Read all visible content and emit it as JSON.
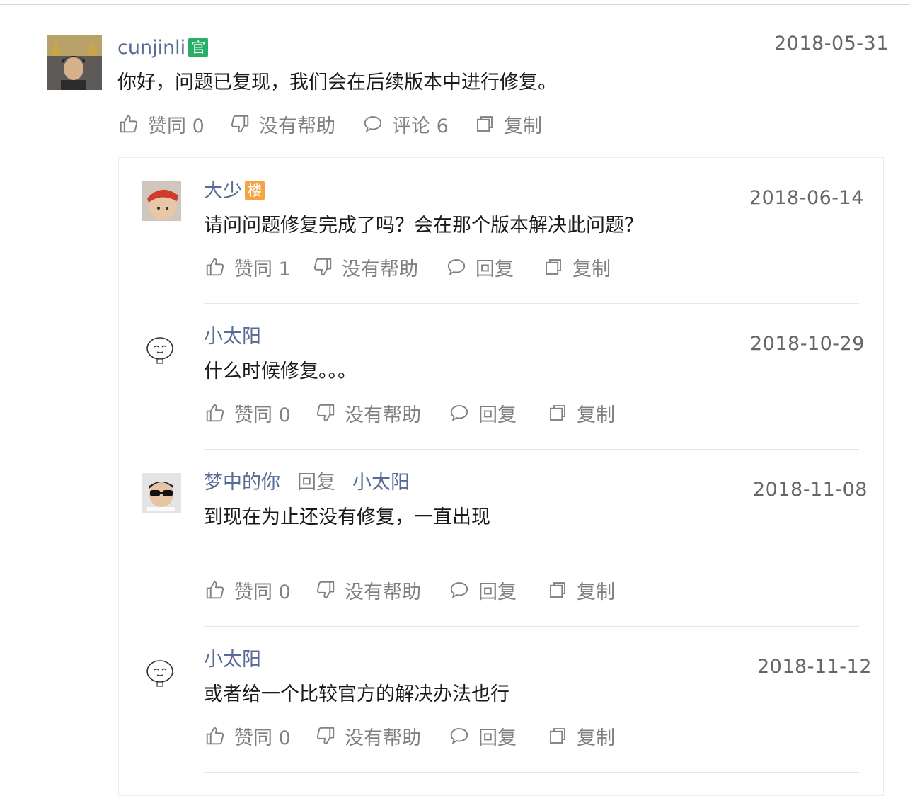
{
  "main_post": {
    "author": "cunjinli",
    "badge": "官",
    "badge_color": "#2aae67",
    "date": "2018-05-31",
    "content": "你好，问题已复现，我们会在后续版本中进行修复。",
    "actions": {
      "like": "赞同 0",
      "dislike": "没有帮助",
      "comment": "评论 6",
      "copy": "复制"
    }
  },
  "replies": [
    {
      "author": "大少",
      "badge": "楼",
      "badge_color": "#f5a344",
      "date": "2018-06-14",
      "content": "请问问题修复完成了吗？会在那个版本解决此问题？",
      "actions": {
        "like": "赞同 1",
        "dislike": "没有帮助",
        "reply": "回复",
        "copy": "复制"
      }
    },
    {
      "author": "小太阳",
      "date": "2018-10-29",
      "content": "什么时候修复。。。",
      "actions": {
        "like": "赞同 0",
        "dislike": "没有帮助",
        "reply": "回复",
        "copy": "复制"
      }
    },
    {
      "author": "梦中的你",
      "reply_word": "回复",
      "reply_to": "小太阳",
      "date": "2018-11-08",
      "content": "到现在为止还没有修复，一直出现",
      "actions": {
        "like": "赞同 0",
        "dislike": "没有帮助",
        "reply": "回复",
        "copy": "复制"
      }
    },
    {
      "author": "小太阳",
      "date": "2018-11-12",
      "content": "或者给一个比较官方的解决办法也行",
      "actions": {
        "like": "赞同 0",
        "dislike": "没有帮助",
        "reply": "回复",
        "copy": "复制"
      }
    }
  ]
}
